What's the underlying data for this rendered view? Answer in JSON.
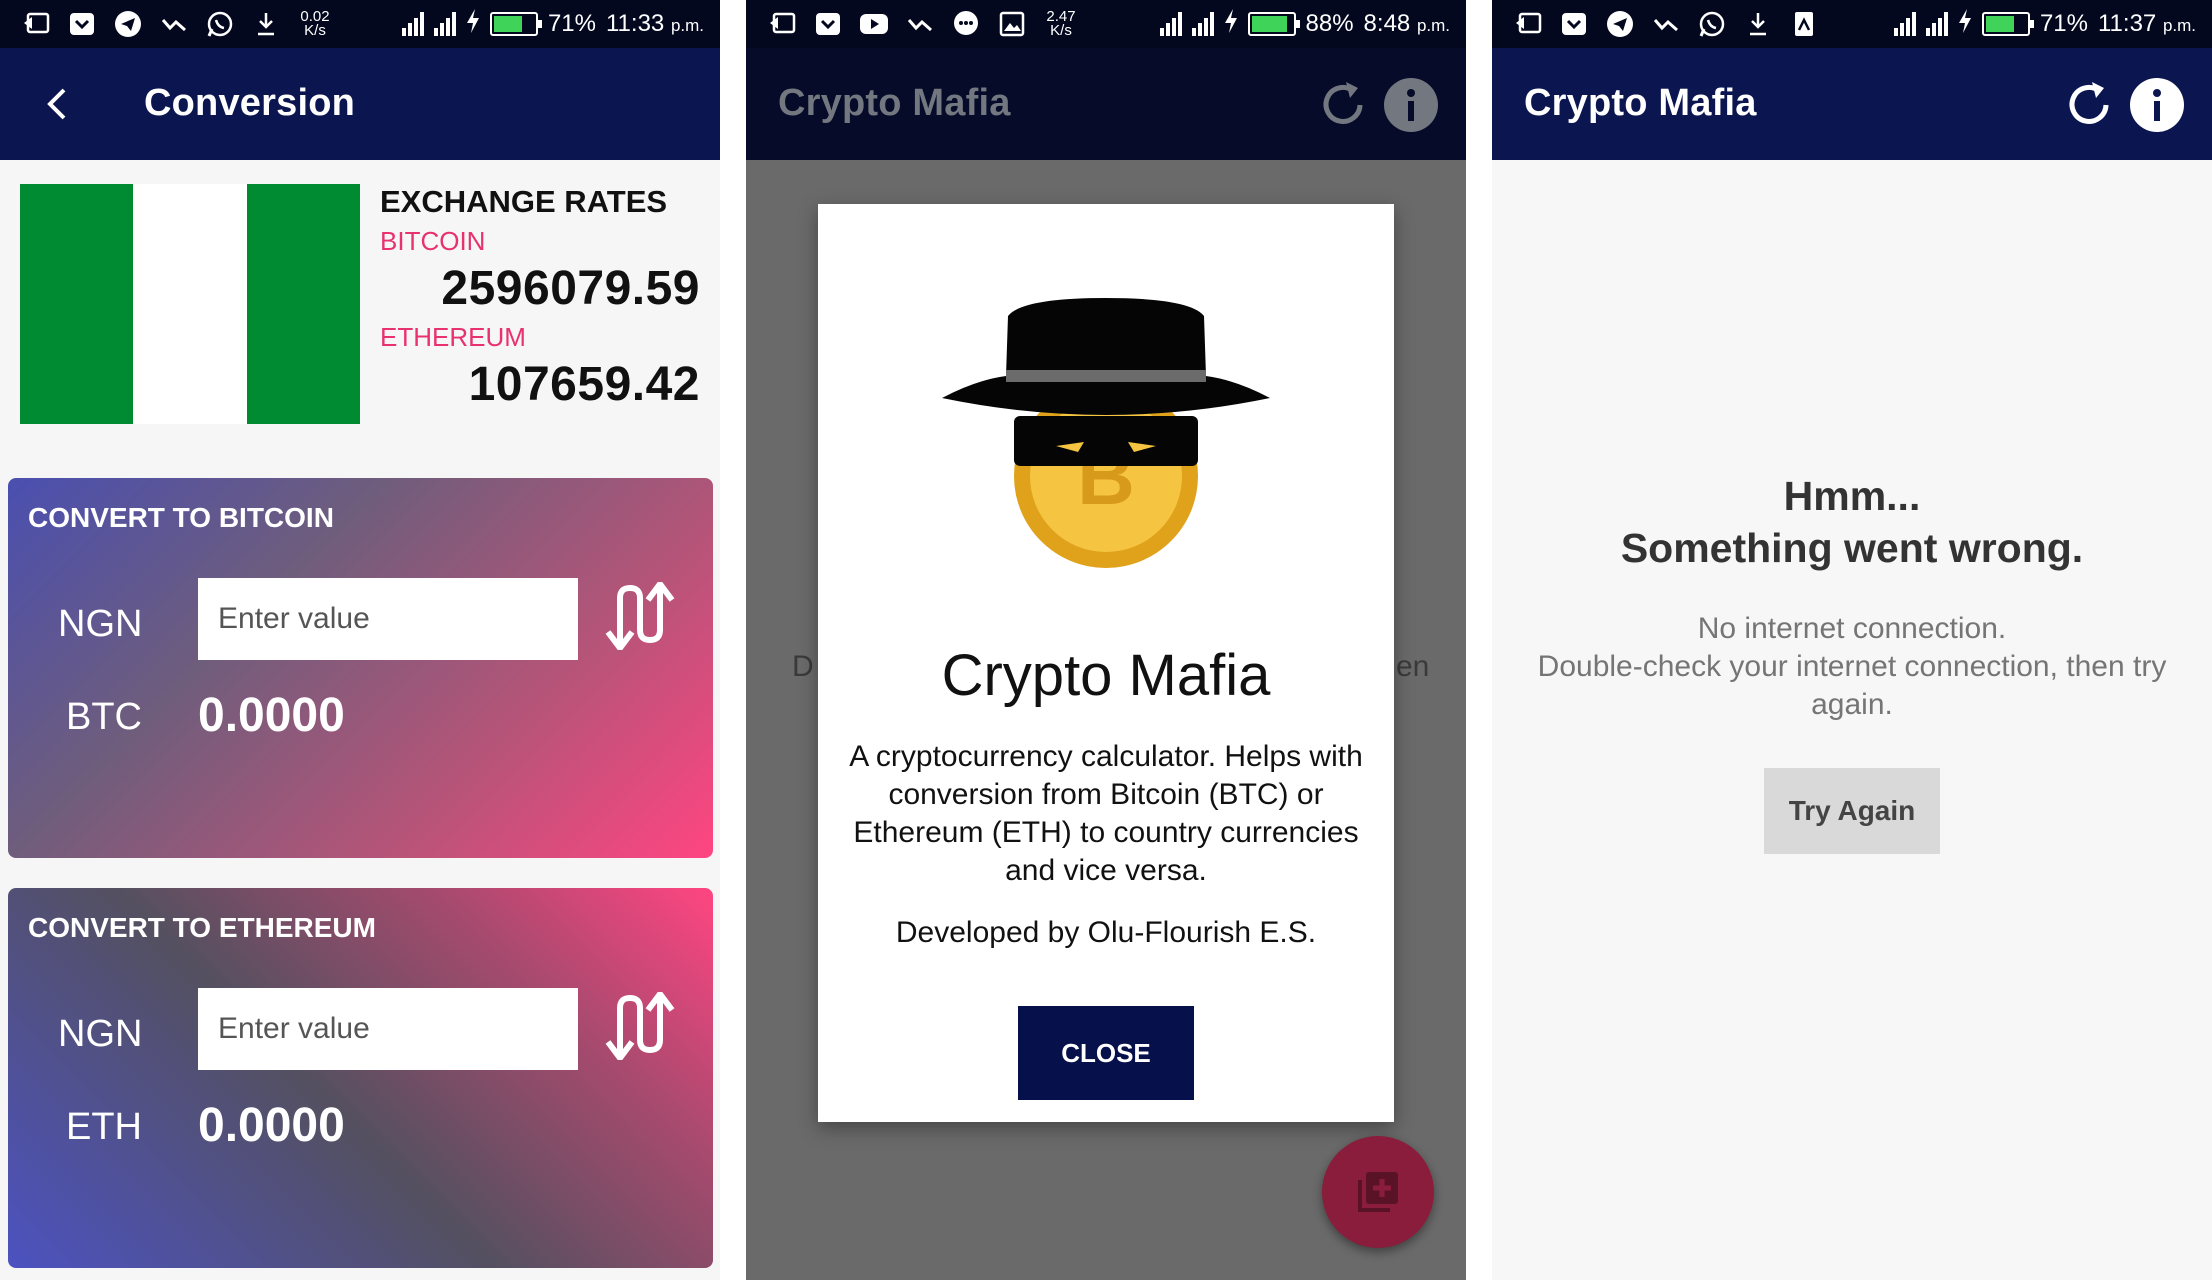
{
  "status_bars": [
    {
      "speed": "0.02\nK/s",
      "battery": "71%",
      "battery_level": 0.71,
      "time": "11:33",
      "ampm": "p.m."
    },
    {
      "speed": "2.47\nK/s",
      "battery": "88%",
      "battery_level": 0.88,
      "time": "8:48",
      "ampm": "p.m."
    },
    {
      "speed": "",
      "battery": "71%",
      "battery_level": 0.71,
      "time": "11:37",
      "ampm": "p.m."
    }
  ],
  "conversion": {
    "title": "Conversion",
    "flag_colors": [
      "#008a32",
      "#ffffff",
      "#008a32"
    ],
    "rates": {
      "title": "EXCHANGE RATES",
      "bitcoin_label": "BITCOIN",
      "bitcoin_value": "2596079.59",
      "ethereum_label": "ETHEREUM",
      "ethereum_value": "107659.42"
    },
    "btc_card": {
      "title": "CONVERT TO BITCOIN",
      "from_currency": "NGN",
      "input_placeholder": "Enter value",
      "to_currency": "BTC",
      "result": "0.0000"
    },
    "eth_card": {
      "title": "CONVERT TO ETHEREUM",
      "from_currency": "NGN",
      "input_placeholder": "Enter value",
      "to_currency": "ETH",
      "result": "0.0000"
    }
  },
  "about": {
    "app_title": "Crypto Mafia",
    "bg_left": "D",
    "bg_right": "en",
    "dialog": {
      "title": "Crypto Mafia",
      "description": "A cryptocurrency calculator. Helps with conversion from Bitcoin (BTC) or Ethereum (ETH) to country currencies and vice versa.",
      "developer": "Developed by Olu-Flourish E.S.",
      "close_label": "CLOSE"
    }
  },
  "error": {
    "app_title": "Crypto Mafia",
    "title_line1": "Hmm...",
    "title_line2": "Something went wrong.",
    "message": "No internet connection.\nDouble-check your internet connection, then try again.",
    "try_again_label": "Try Again"
  },
  "colors": {
    "app_bar": "#0b1650",
    "status_bar": "#03081f",
    "accent_pink": "#e8326f",
    "close_button": "#06104a",
    "fab": "#8a1d3c"
  }
}
